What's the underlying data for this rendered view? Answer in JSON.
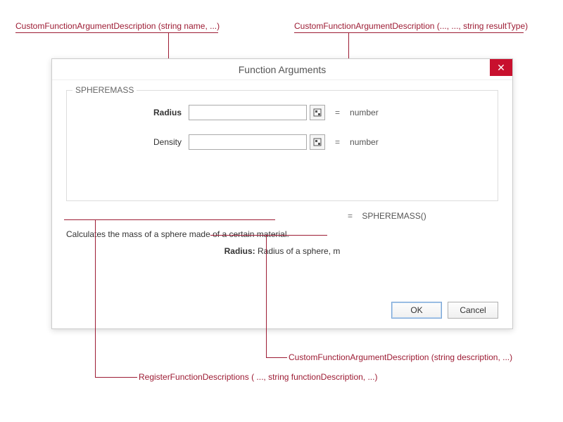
{
  "annotations": {
    "top_left": "CustomFunctionArgumentDescription (string name, ...)",
    "top_right": "CustomFunctionArgumentDescription (..., ..., string resultType)",
    "bottom_register": "RegisterFunctionDescriptions ( ..., string functionDescription, ...)",
    "bottom_desc": "CustomFunctionArgumentDescription (string description, ...)"
  },
  "dialog": {
    "title": "Function Arguments",
    "function_name": "SPHEREMASS",
    "args": [
      {
        "name": "Radius",
        "bold": true,
        "value": "",
        "type": "number"
      },
      {
        "name": "Density",
        "bold": false,
        "value": "",
        "type": "number"
      }
    ],
    "result_label": "SPHEREMASS()",
    "function_description": "Calculates the mass of a sphere made of a certain material.",
    "arg_help": {
      "name": "Radius:",
      "text": " Radius of a sphere, m"
    },
    "buttons": {
      "ok": "OK",
      "cancel": "Cancel"
    },
    "eq": "="
  }
}
